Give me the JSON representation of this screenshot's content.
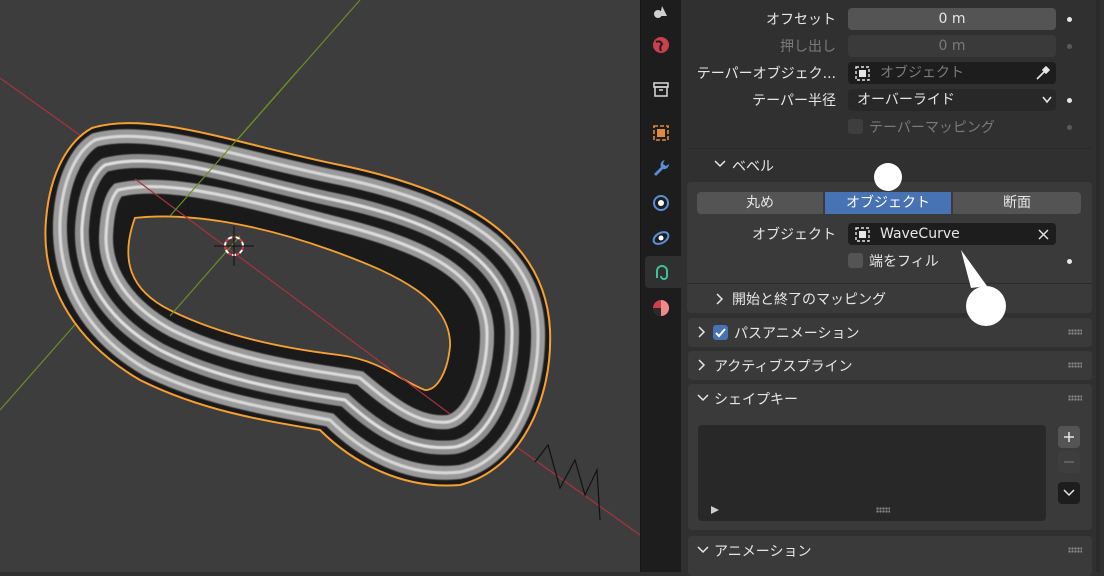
{
  "properties": {
    "offset_label": "オフセット",
    "offset_value": "0 m",
    "extrude_label": "押し出し",
    "extrude_value": "0 m",
    "taper_object_label": "テーパーオブジェク...",
    "taper_object_placeholder": "オブジェクト",
    "taper_radius_label": "テーパー半径",
    "taper_radius_value": "オーバーライド",
    "taper_mapping_label": "テーパーマッピング",
    "bevel_header": "ベベル",
    "bevel_modes": [
      "丸め",
      "オブジェクト",
      "断面"
    ],
    "bevel_active_mode": "オブジェクト",
    "bevel_object_label": "オブジェクト",
    "bevel_object_value": "WaveCurve",
    "fill_caps_label": "端をフィル",
    "start_end_mapping": "開始と終了のマッピング",
    "path_animation": "パスアニメーション",
    "active_spline": "アクティブスプライン",
    "shape_keys": "シェイプキー",
    "animation": "アニメーション"
  },
  "tabs": [
    "scene-icon",
    "world-icon",
    "collection-icon",
    "object-icon",
    "modifier-icon",
    "particles-icon",
    "physics-icon",
    "curve-data-icon",
    "material-icon"
  ],
  "active_tab": "curve-data-icon",
  "colors": {
    "accent": "#4772b3",
    "selection_outline": "#f5a030",
    "x_axis": "#b0303d",
    "y_axis": "#6a8f25"
  }
}
